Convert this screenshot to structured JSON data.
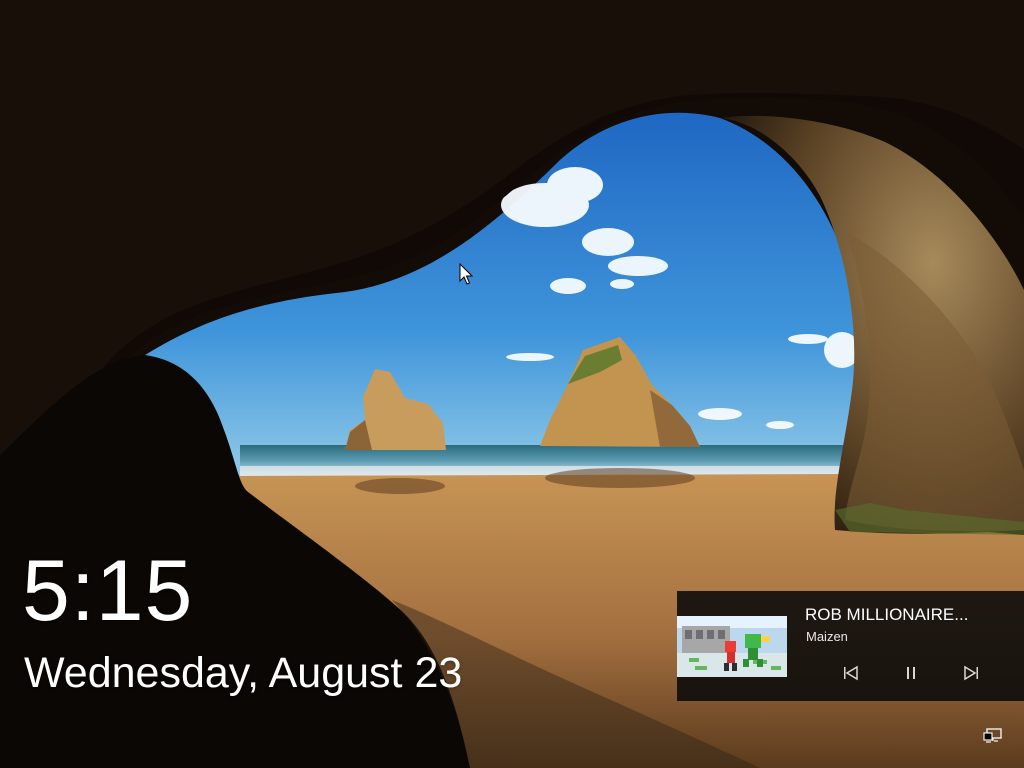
{
  "lock_screen": {
    "time": "5:15",
    "date": "Wednesday, August 23"
  },
  "media": {
    "title": "ROB MILLIONAIRE...",
    "artist": "Maizen",
    "controls": {
      "previous_icon": "previous-track-icon",
      "pause_icon": "pause-icon",
      "next_icon": "next-track-icon"
    }
  },
  "status": {
    "network_icon": "network-icon"
  },
  "colors": {
    "text": "#ffffff",
    "media_panel": "#0a0a0a",
    "sky": "#2d7fd1",
    "sand": "#b98b4f"
  }
}
